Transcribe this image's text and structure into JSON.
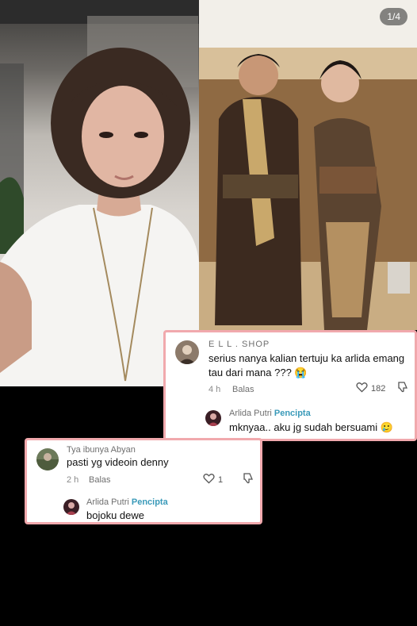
{
  "media": {
    "page_indicator": "1/4"
  },
  "comment_card_1": {
    "comment": {
      "username": "E L L . SHOP",
      "text": "serius nanya kalian tertuju ka arlida emang tau dari mana ??? 😭",
      "time": "4 h",
      "reply_label": "Balas",
      "likes": "182"
    },
    "reply": {
      "username": "Arlida Putri",
      "badge": "Pencipta",
      "text": "mknyaa.. aku jg sudah bersuami 🥲"
    }
  },
  "comment_card_2": {
    "comment": {
      "username": "Tya ibunya Abyan",
      "text": "pasti yg videoin denny",
      "time": "2 h",
      "reply_label": "Balas",
      "likes": "1"
    },
    "reply": {
      "username": "Arlida Putri",
      "badge": "Pencipta",
      "text": "bojoku dewe"
    }
  },
  "colors": {
    "card_border": "#f1a9ad",
    "creator_badge": "#3a9ab9",
    "background": "#000000"
  }
}
